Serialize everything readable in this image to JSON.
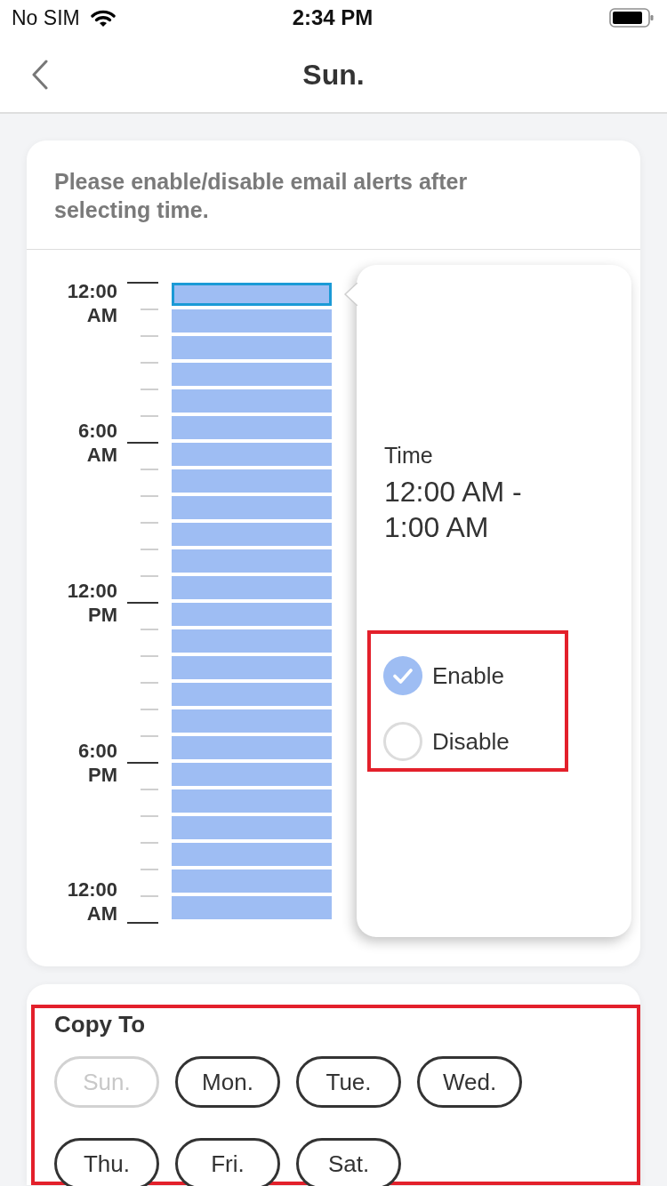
{
  "status_bar": {
    "carrier": "No SIM",
    "time": "2:34 PM"
  },
  "nav_bar": {
    "title": "Sun."
  },
  "schedule": {
    "instruction": "Please enable/disable email alerts after selecting time.",
    "axis_labels": [
      "12:00 AM",
      "6:00 AM",
      "12:00 PM",
      "6:00 PM",
      "12:00 AM"
    ],
    "slots": [
      {
        "selected": true,
        "enabled": true
      },
      {
        "selected": false,
        "enabled": true
      },
      {
        "selected": false,
        "enabled": true
      },
      {
        "selected": false,
        "enabled": true
      },
      {
        "selected": false,
        "enabled": true
      },
      {
        "selected": false,
        "enabled": true
      },
      {
        "selected": false,
        "enabled": true
      },
      {
        "selected": false,
        "enabled": true
      },
      {
        "selected": false,
        "enabled": true
      },
      {
        "selected": false,
        "enabled": true
      },
      {
        "selected": false,
        "enabled": true
      },
      {
        "selected": false,
        "enabled": true
      },
      {
        "selected": false,
        "enabled": true
      },
      {
        "selected": false,
        "enabled": true
      },
      {
        "selected": false,
        "enabled": true
      },
      {
        "selected": false,
        "enabled": true
      },
      {
        "selected": false,
        "enabled": true
      },
      {
        "selected": false,
        "enabled": true
      },
      {
        "selected": false,
        "enabled": true
      },
      {
        "selected": false,
        "enabled": true
      },
      {
        "selected": false,
        "enabled": true
      },
      {
        "selected": false,
        "enabled": true
      },
      {
        "selected": false,
        "enabled": true
      },
      {
        "selected": false,
        "enabled": true
      }
    ],
    "popover": {
      "label": "Time",
      "value": "12:00 AM - 1:00 AM",
      "options": [
        {
          "label": "Enable",
          "selected": true
        },
        {
          "label": "Disable",
          "selected": false
        }
      ]
    }
  },
  "copy_to": {
    "title": "Copy To",
    "days": [
      {
        "label": "Sun.",
        "disabled": true,
        "selected": false
      },
      {
        "label": "Mon.",
        "disabled": false,
        "selected": false
      },
      {
        "label": "Tue.",
        "disabled": false,
        "selected": false
      },
      {
        "label": "Wed.",
        "disabled": false,
        "selected": false
      },
      {
        "label": "Thu.",
        "disabled": false,
        "selected": false
      },
      {
        "label": "Fri.",
        "disabled": false,
        "selected": false
      },
      {
        "label": "Sat.",
        "disabled": false,
        "selected": false
      }
    ]
  }
}
